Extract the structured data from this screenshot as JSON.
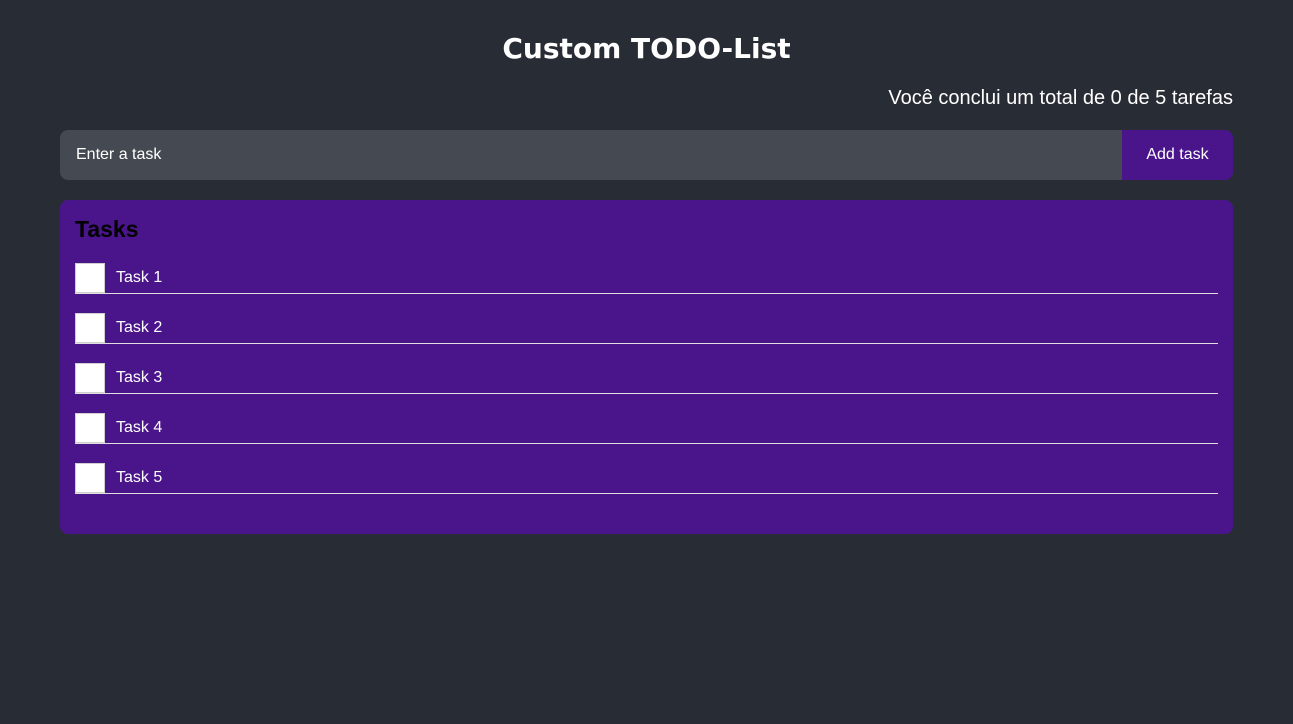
{
  "header": {
    "title": "Custom TODO-List"
  },
  "summary": {
    "text": "Você conclui um total de 0 de 5 tarefas",
    "completed": 0,
    "total": 5
  },
  "new_task": {
    "placeholder": "Enter a task",
    "value": "",
    "add_label": "Add task"
  },
  "tasks_panel": {
    "heading": "Tasks",
    "items": [
      {
        "label": "Task 1",
        "checked": false
      },
      {
        "label": "Task 2",
        "checked": false
      },
      {
        "label": "Task 3",
        "checked": false
      },
      {
        "label": "Task 4",
        "checked": false
      },
      {
        "label": "Task 5",
        "checked": false
      }
    ]
  },
  "colors": {
    "background": "#282c34",
    "accent": "#4a158a",
    "input_background": "#454a52",
    "text": "#ffffff",
    "heading_text": "#000000"
  }
}
